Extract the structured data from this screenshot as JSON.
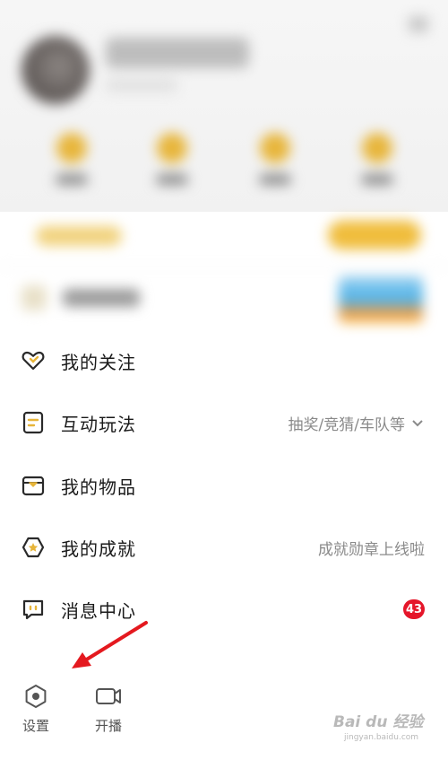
{
  "menu": [
    {
      "label": "我的关注",
      "right": "",
      "icon": "heart-icon"
    },
    {
      "label": "互动玩法",
      "right": "抽奖/竞猜/车队等",
      "icon": "card-icon"
    },
    {
      "label": "我的物品",
      "right": "",
      "icon": "box-icon"
    },
    {
      "label": "我的成就",
      "right": "成就勋章上线啦",
      "icon": "hexagon-star-icon"
    },
    {
      "label": "消息中心",
      "right": "",
      "icon": "message-icon",
      "badge": "43"
    }
  ],
  "bottom": {
    "settings_label": "设置",
    "broadcast_label": "开播"
  },
  "watermark": {
    "brand": "Bai du 经验",
    "url": "jingyan.baidu.com"
  },
  "colors": {
    "accent": "#e7b53a",
    "badge": "#e5162a",
    "annotation_arrow": "#e4191f"
  }
}
